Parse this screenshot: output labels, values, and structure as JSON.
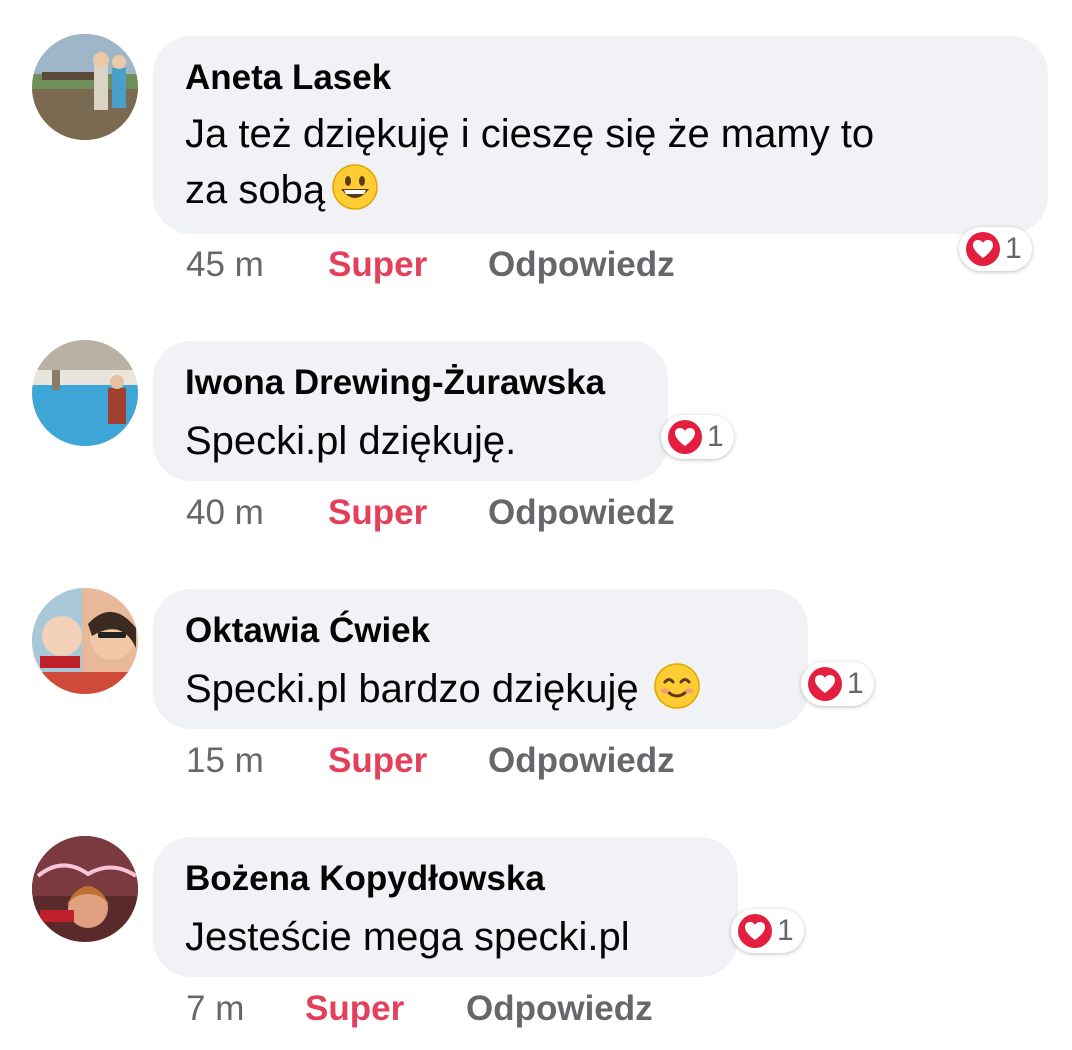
{
  "comments": [
    {
      "author": "Aneta Lasek",
      "text_lines": [
        "Ja też dziękuję i cieszę się że mamy to",
        "za sobą"
      ],
      "emoji": "grinning-face",
      "time": "45 m",
      "like_label": "Super",
      "reply_label": "Odpowiedz",
      "reaction_count": "1"
    },
    {
      "author": "Iwona Drewing-Żurawska",
      "text": "Specki.pl dziękuję.",
      "time": "40 m",
      "like_label": "Super",
      "reply_label": "Odpowiedz",
      "reaction_count": "1"
    },
    {
      "author": "Oktawia Ćwiek",
      "text": "Specki.pl bardzo dziękuję",
      "emoji": "smiling-face",
      "time": "15 m",
      "like_label": "Super",
      "reply_label": "Odpowiedz",
      "reaction_count": "1"
    },
    {
      "author": "Bożena Kopydłowska",
      "text": "Jesteście mega specki.pl",
      "time": "7 m",
      "like_label": "Super",
      "reply_label": "Odpowiedz",
      "reaction_count": "1"
    }
  ],
  "colors": {
    "bubble": "#f0f2f5",
    "like_active": "#e4405b",
    "meta_text": "#65676b",
    "heart": "#e41e3f"
  },
  "icons": {
    "reaction": "heart-icon"
  }
}
